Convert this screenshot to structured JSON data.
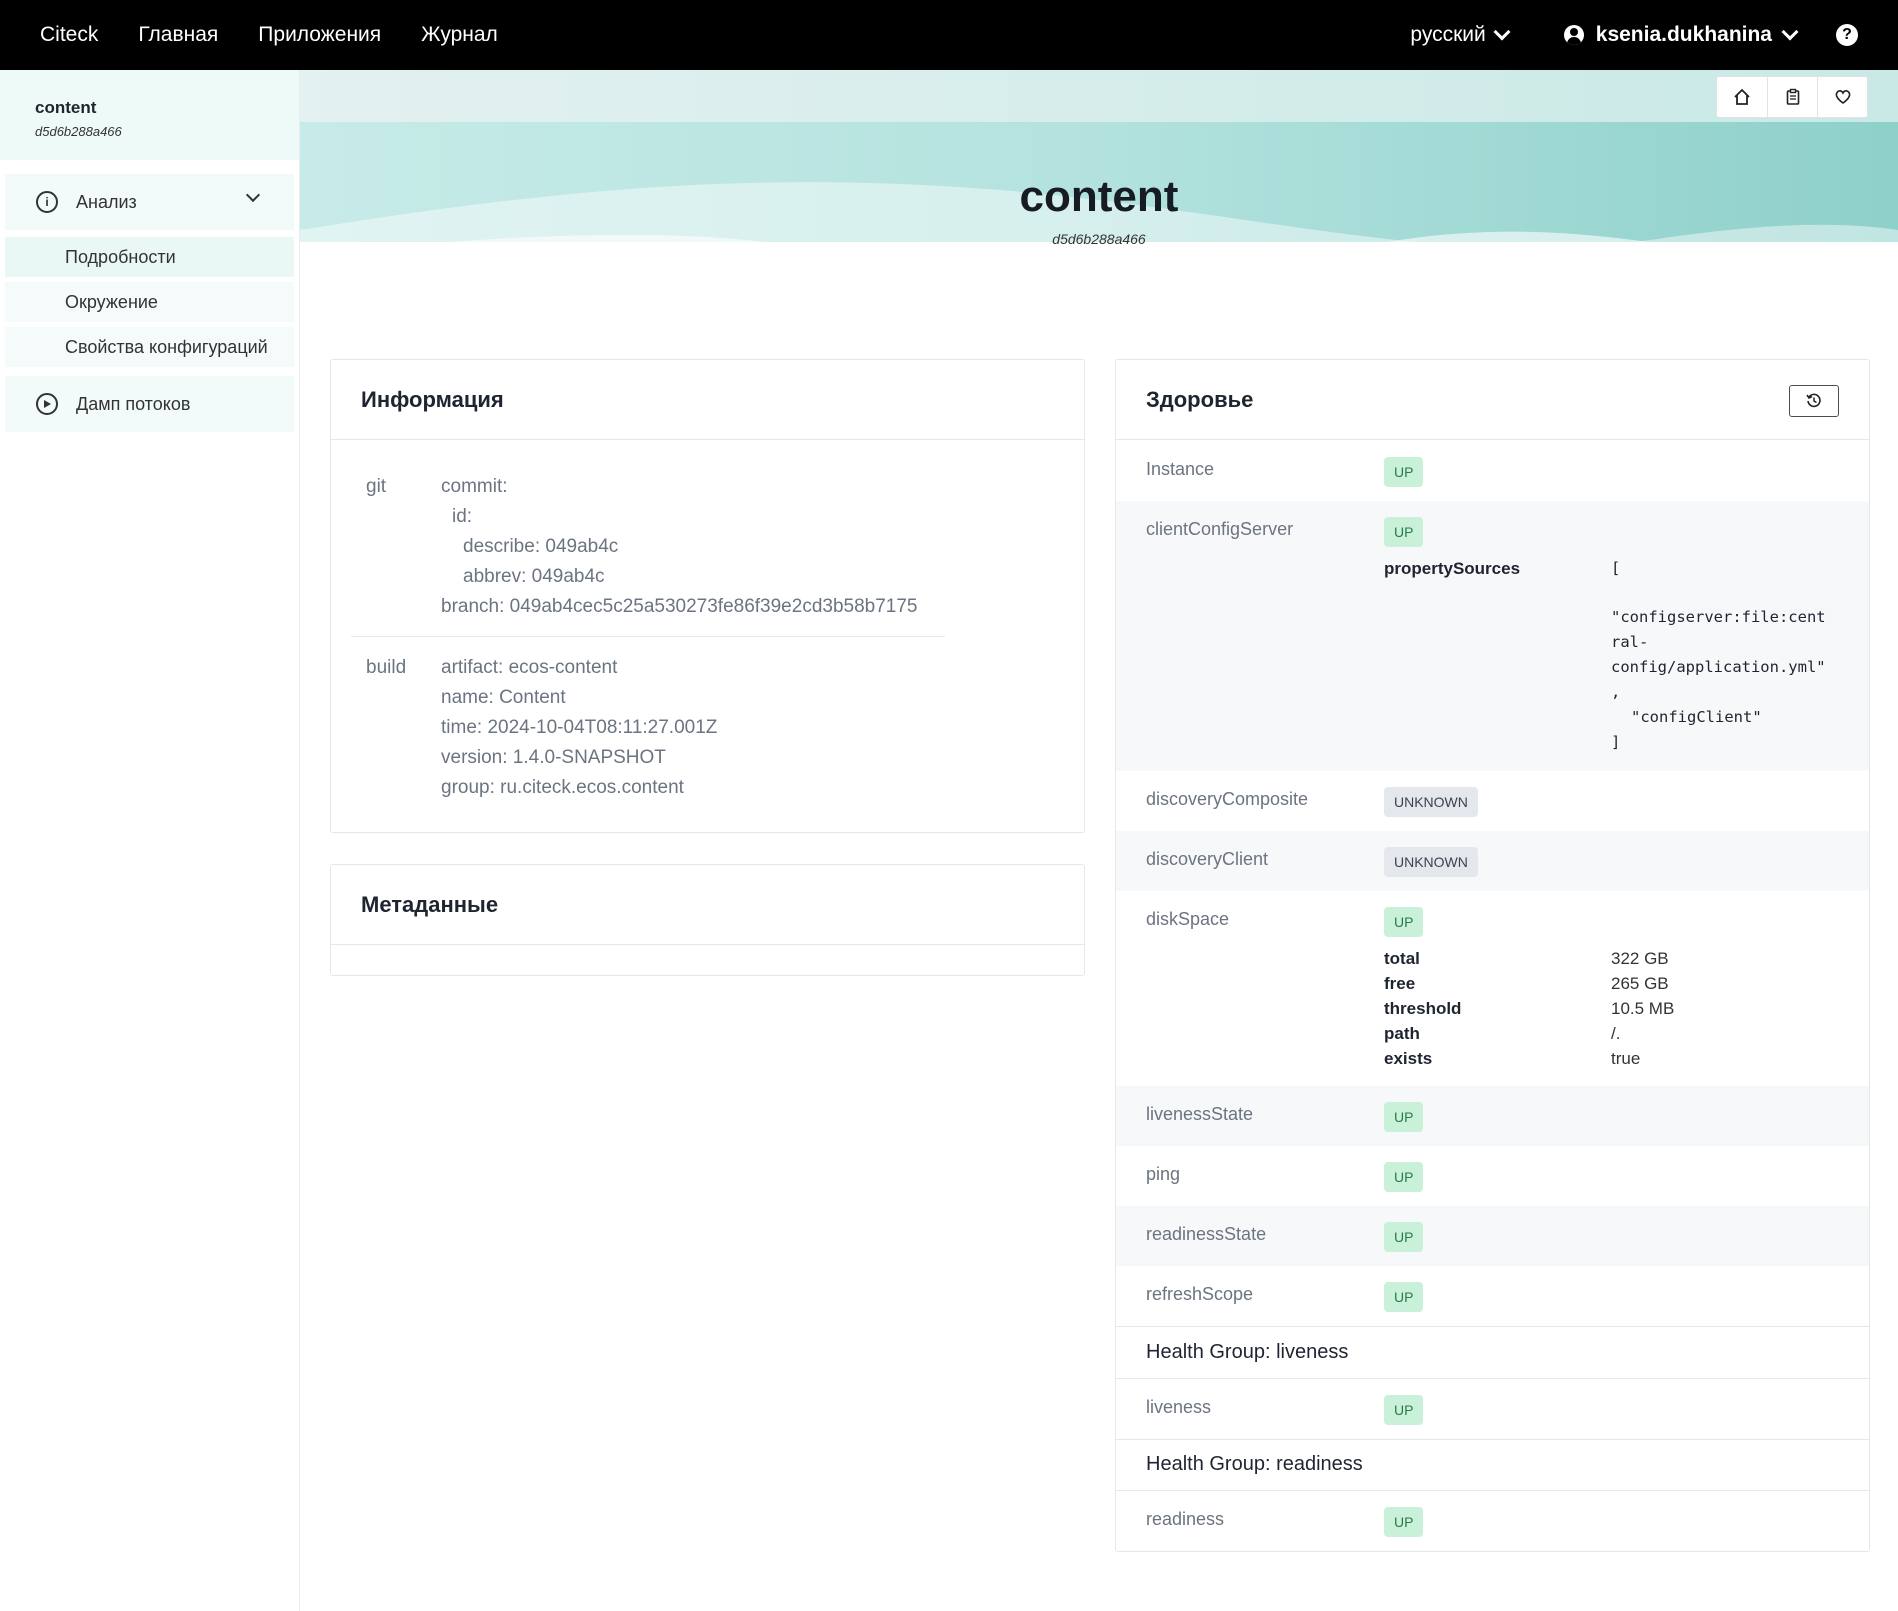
{
  "topbar": {
    "brand": "Citeck",
    "nav": [
      "Главная",
      "Приложения",
      "Журнал"
    ],
    "language": "русский",
    "username": "ksenia.dukhanina",
    "help": "?"
  },
  "sidebar": {
    "app_name": "content",
    "app_id": "d5d6b288a466",
    "group_label": "Анализ",
    "items": [
      "Подробности",
      "Окружение",
      "Свойства конфигураций"
    ],
    "threads_label": "Дамп потоков"
  },
  "header": {
    "title": "content",
    "subtitle": "d5d6b288a466"
  },
  "info": {
    "title": "Информация",
    "git_key": "git",
    "git_lines": [
      "commit:",
      "id:",
      "describe: 049ab4c",
      "abbrev: 049ab4c",
      "branch: 049ab4cec5c25a530273fe86f39e2cd3b58b7175"
    ],
    "build_key": "build",
    "build_lines": [
      "artifact: ecos-content",
      "name: Content",
      "time: 2024-10-04T08:11:27.001Z",
      "version: 1.4.0-SNAPSHOT",
      "group: ru.citeck.ecos.content"
    ]
  },
  "metadata": {
    "title": "Метаданные"
  },
  "health": {
    "title": "Здоровье",
    "rows": [
      {
        "name": "Instance",
        "status": "UP"
      },
      {
        "name": "clientConfigServer",
        "status": "UP"
      },
      {
        "name": "discoveryComposite",
        "status": "UNKNOWN"
      },
      {
        "name": "discoveryClient",
        "status": "UNKNOWN"
      },
      {
        "name": "diskSpace",
        "status": "UP"
      },
      {
        "name": "livenessState",
        "status": "UP"
      },
      {
        "name": "ping",
        "status": "UP"
      },
      {
        "name": "readinessState",
        "status": "UP"
      },
      {
        "name": "refreshScope",
        "status": "UP"
      }
    ],
    "property_sources_key": "propertySources",
    "property_sources_lines": [
      "[",
      "\"configserver:file:cent",
      "ral-",
      "config/application.yml\"",
      ",",
      "\"configClient\"",
      "]"
    ],
    "disk_details": [
      {
        "key": "total",
        "value": "322 GB"
      },
      {
        "key": "free",
        "value": "265 GB"
      },
      {
        "key": "threshold",
        "value": "10.5 MB"
      },
      {
        "key": "path",
        "value": "/."
      },
      {
        "key": "exists",
        "value": "true"
      }
    ],
    "groups": [
      {
        "title": "Health Group: liveness",
        "name": "liveness",
        "status": "UP"
      },
      {
        "title": "Health Group: readiness",
        "name": "readiness",
        "status": "UP"
      }
    ]
  },
  "colors": {
    "topbar_bg": "#000000",
    "status_up_bg": "#c9f1d9",
    "status_unknown_bg": "#e4e7eb",
    "banner_teal": "#b8e4e0"
  }
}
